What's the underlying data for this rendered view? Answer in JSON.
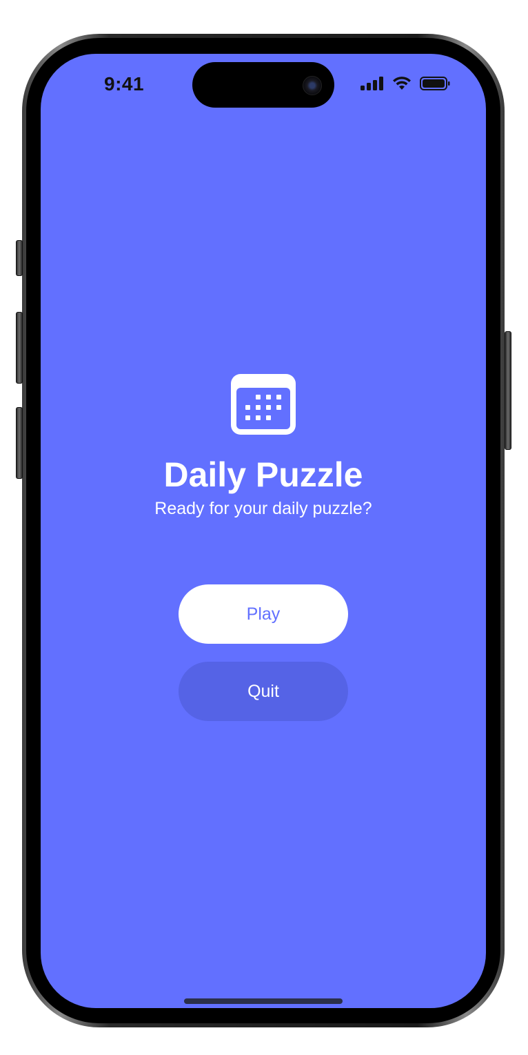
{
  "status_bar": {
    "time": "9:41"
  },
  "app": {
    "icon": "calendar-icon",
    "title": "Daily Puzzle",
    "subtitle": "Ready for your daily puzzle?"
  },
  "buttons": {
    "play_label": "Play",
    "quit_label": "Quit"
  },
  "colors": {
    "background": "#6270ff",
    "play_button_bg": "#ffffff",
    "play_button_text": "#6270ff",
    "quit_button_bg": "#5563e6",
    "quit_button_text": "#ffffff"
  }
}
